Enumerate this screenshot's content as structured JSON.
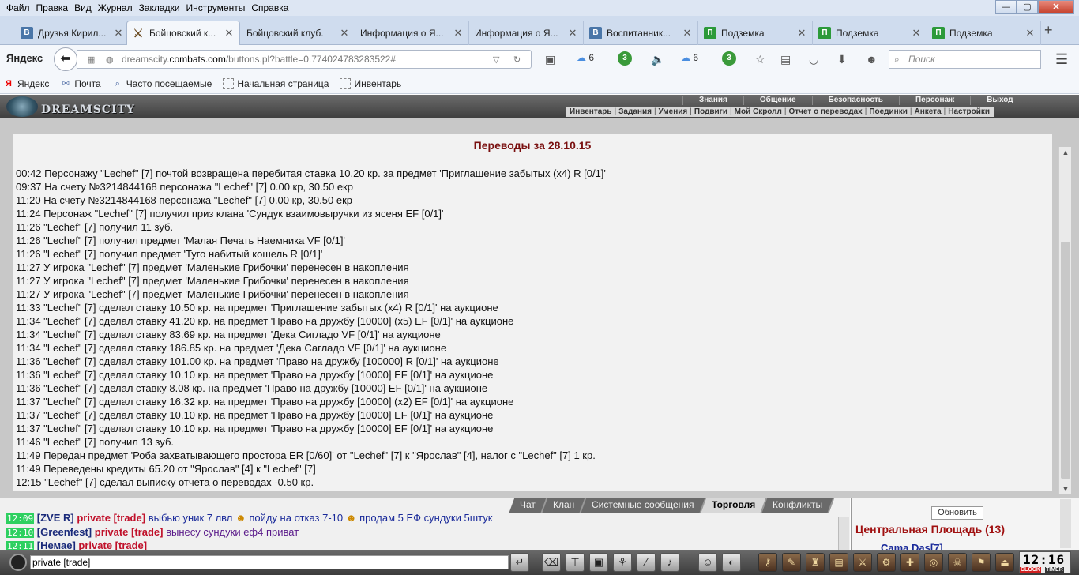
{
  "menubar": {
    "items": [
      "Файл",
      "Правка",
      "Вид",
      "Журнал",
      "Закладки",
      "Инструменты",
      "Справка"
    ]
  },
  "window_controls": {
    "minimize": "—",
    "maximize": "▢",
    "close": "✕"
  },
  "tabs": [
    {
      "label": "Друзья Кирил...",
      "icon": "vk-icon"
    },
    {
      "label": "Бойцовский к...",
      "icon": "swords-icon",
      "active": true
    },
    {
      "label": "Бойцовский клуб.",
      "icon": "none"
    },
    {
      "label": "Информация о Я...",
      "icon": "none"
    },
    {
      "label": "Информация о Я...",
      "icon": "none"
    },
    {
      "label": "Воспитанник...",
      "icon": "vk-icon"
    },
    {
      "label": "Подземка",
      "icon": "pz-icon"
    },
    {
      "label": "Подземка",
      "icon": "pz-icon"
    },
    {
      "label": "Подземка",
      "icon": "pz-icon"
    }
  ],
  "new_tab": "+",
  "nav": {
    "brand": "Яндекс",
    "url_host_prefix": "dreamscity.",
    "url_host": "combats.com",
    "url_path": "/buttons.pl?battle=0.774024783283522#",
    "weather1": "6",
    "badge1": "3",
    "weather2": "6",
    "badge2": "3",
    "search_placeholder": "Поиск"
  },
  "bookmarks": [
    {
      "label": "Яндекс",
      "icon": "yandex-icon"
    },
    {
      "label": "Почта",
      "icon": "mail-icon"
    },
    {
      "label": "Часто посещаемые",
      "icon": "frequent-icon"
    },
    {
      "label": "Начальная страница",
      "icon": "page-icon"
    },
    {
      "label": "Инвентарь",
      "icon": "page-icon"
    }
  ],
  "game": {
    "logo_text": "DREAMSCITY",
    "top_menu": [
      "Знания",
      "Общение",
      "Безопасность",
      "Персонаж",
      "Выход"
    ],
    "sub_menu": [
      "Инвентарь",
      "Задания",
      "Умения",
      "Подвиги",
      "Мой Скролл",
      "Отчет о переводах",
      "Поединки",
      "Анкета",
      "Настройки"
    ]
  },
  "report": {
    "title": "Переводы за 28.10.15",
    "lines": [
      "00:42 Персонажу \"Lechef\" [7] почтой возвращена перебитая ставка 10.20 кр. за предмет 'Приглашение забытых (x4) R [0/1]'",
      "09:37 На счету №3214844168 персонажа \"Lechef\" [7] 0.00 кр, 30.50 екр",
      "11:20 На счету №3214844168 персонажа \"Lechef\" [7] 0.00 кр, 30.50 екр",
      "11:24 Персонаж \"Lechef\" [7] получил приз клана 'Сундук взаимовыручки из ясеня EF [0/1]'",
      "11:26 \"Lechef\" [7] получил 11 зуб.",
      "11:26 \"Lechef\" [7] получил предмет 'Малая Печать Наемника VF [0/1]'",
      "11:26 \"Lechef\" [7] получил предмет 'Туго набитый кошель R [0/1]'",
      "11:27 У игрока \"Lechef\" [7] предмет 'Маленькие Грибочки' перенесен в накопления",
      "11:27 У игрока \"Lechef\" [7] предмет 'Маленькие Грибочки' перенесен в накопления",
      "11:27 У игрока \"Lechef\" [7] предмет 'Маленькие Грибочки' перенесен в накопления",
      "11:33 \"Lechef\" [7] сделал ставку 10.50 кр. на предмет 'Приглашение забытых (x4) R [0/1]' на аукционе",
      "11:34 \"Lechef\" [7] сделал ставку 41.20 кр. на предмет 'Право на дружбу [10000] (x5) EF [0/1]' на аукционе",
      "11:34 \"Lechef\" [7] сделал ставку 83.69 кр. на предмет 'Дека Сигладо VF [0/1]' на аукционе",
      "11:34 \"Lechef\" [7] сделал ставку 186.85 кр. на предмет 'Дека Сагладо VF [0/1]' на аукционе",
      "11:36 \"Lechef\" [7] сделал ставку 101.00 кр. на предмет 'Право на дружбу [100000] R [0/1]' на аукционе",
      "11:36 \"Lechef\" [7] сделал ставку 10.10 кр. на предмет 'Право на дружбу [10000] EF [0/1]' на аукционе",
      "11:36 \"Lechef\" [7] сделал ставку 8.08 кр. на предмет 'Право на дружбу [10000] EF [0/1]' на аукционе",
      "11:37 \"Lechef\" [7] сделал ставку 16.32 кр. на предмет 'Право на дружбу [10000] (x2) EF [0/1]' на аукционе",
      "11:37 \"Lechef\" [7] сделал ставку 10.10 кр. на предмет 'Право на дружбу [10000] EF [0/1]' на аукционе",
      "11:37 \"Lechef\" [7] сделал ставку 10.10 кр. на предмет 'Право на дружбу [10000] EF [0/1]' на аукционе",
      "11:46 \"Lechef\" [7] получил 13 зуб.",
      "11:49 Передан предмет 'Роба захватывающего простора ER [0/60]' от \"Lechef\" [7] к \"Ярослав\" [4], налог с \"Lechef\" [7] 1 кр.",
      "11:49 Переведены кредиты 65.20 от \"Ярослав\" [4] к \"Lechef\" [7]",
      "12:15 \"Lechef\" [7] сделал выписку отчета о переводах -0.50 кр."
    ]
  },
  "chat": {
    "tabs": [
      "Чат",
      "Клан",
      "Системные сообщения",
      "Торговля",
      "Конфликты"
    ],
    "active_tab": "Торговля",
    "lines": [
      {
        "time": "12:09",
        "nick_open": "[",
        "nick": "ZVE R",
        "nick_close": "]",
        "tag": "private [trade]",
        "text": "выбью уник 7 лвл",
        "extra": "пойду на отказ 7-10",
        "extra2": "продам 5 ЕФ сундуки 5штук"
      },
      {
        "time": "12:10",
        "nick_open": "[",
        "nick": "Greenfest",
        "nick_close": "]",
        "tag": "private [trade]",
        "text": "вынесу сундуки еф4 приват"
      },
      {
        "time": "12:11",
        "nick_open": "[",
        "nick": "Немае",
        "nick_close": "]",
        "tag": "private [trade]",
        "text": ""
      }
    ],
    "input_value": "private [trade]"
  },
  "right_panel": {
    "refresh_label": "Обновить",
    "location": "Центральная Площадь (13)",
    "first_user": "Cama Das[7]"
  },
  "clock": {
    "time": "12:16",
    "label_clock": "CLOCK",
    "label_timer": "TIMER"
  }
}
